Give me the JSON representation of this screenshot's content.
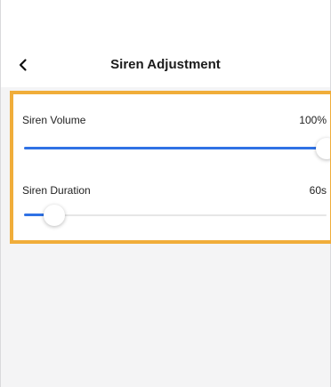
{
  "header": {
    "title": "Siren Adjustment",
    "back_icon": "chevron-left-icon"
  },
  "settings": [
    {
      "label": "Siren Volume",
      "value_text": "100%",
      "level": 1.0
    },
    {
      "label": "Siren Duration",
      "value_text": "60s",
      "level": 0.1
    }
  ],
  "colors": {
    "accent": "#2f72e5",
    "highlight_border": "#f0ad3a",
    "background": "#f4f4f5"
  }
}
